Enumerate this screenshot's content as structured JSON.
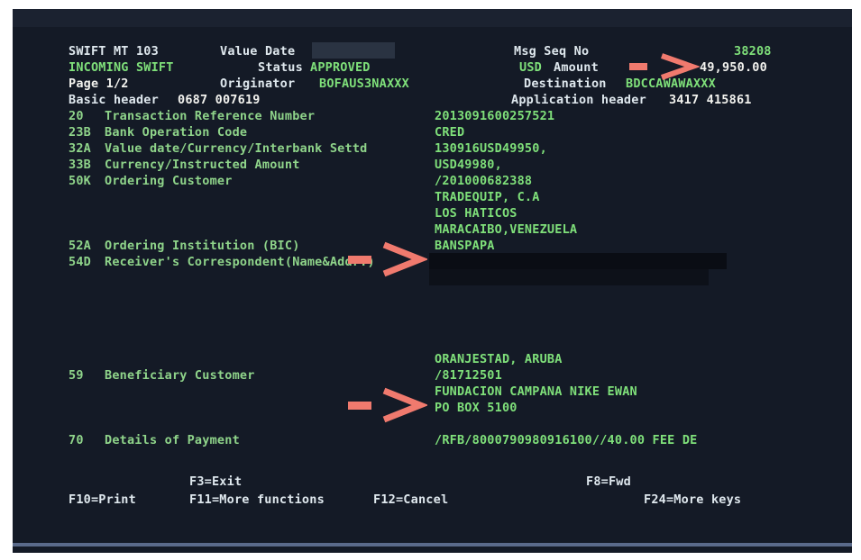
{
  "header": {
    "message_type": "SWIFT MT 103",
    "value_date_label": "Value Date",
    "value_date": "",
    "msg_seq_label": "Msg Seq No",
    "msg_seq": "38208",
    "incoming": "INCOMING SWIFT",
    "status_label": "Status",
    "status_value": "APPROVED",
    "currency_label": "USD",
    "amount_label": "Amount",
    "amount_value": "49,950.00",
    "page": "Page 1/2",
    "originator_label": "Originator",
    "originator_value": "BOFAUS3NAXXX",
    "destination_label": "Destination",
    "destination_value": "BDCCAWAWAXXX",
    "basic_header_label": "Basic header",
    "basic_header_value": "0687 007619",
    "app_header_label": "Application header",
    "app_header_value": "3417 415861"
  },
  "fields": [
    {
      "tag": "20",
      "name": "Transaction Reference Number",
      "value": "2013091600257521"
    },
    {
      "tag": "23B",
      "name": "Bank Operation Code",
      "value": "CRED"
    },
    {
      "tag": "32A",
      "name": "Value date/Currency/Interbank Settd",
      "value": "130916USD49950,"
    },
    {
      "tag": "33B",
      "name": "Currency/Instructed Amount",
      "value": "USD49980,"
    },
    {
      "tag": "50K",
      "name": "Ordering Customer",
      "value": "/201000682388"
    },
    {
      "tag": "",
      "name": "",
      "value": "TRADEQUIP, C.A"
    },
    {
      "tag": "",
      "name": "",
      "value": "LOS HATICOS"
    },
    {
      "tag": "",
      "name": "",
      "value": "MARACAIBO,VENEZUELA"
    },
    {
      "tag": "52A",
      "name": "Ordering Institution (BIC)",
      "value": "BANSPAPA"
    },
    {
      "tag": "54D",
      "name": "Receiver's Correspondent(Name&Addr.)",
      "value": ""
    },
    {
      "tag": "",
      "name": "",
      "value": ""
    },
    {
      "tag": "",
      "name": "",
      "value": "ORANJESTAD, ARUBA"
    },
    {
      "tag": "59",
      "name": "Beneficiary Customer",
      "value": "/81712501"
    },
    {
      "tag": "",
      "name": "",
      "value": "FUNDACION CAMPANA NIKE EWAN"
    },
    {
      "tag": "",
      "name": "",
      "value": "PO BOX 5100"
    },
    {
      "tag": "70",
      "name": "Details of Payment",
      "value": "/RFB/8000790980916100//40.00 FEE DE"
    }
  ],
  "function_keys": {
    "f3": "F3=Exit",
    "f8": "F8=Fwd",
    "f10": "F10=Print",
    "f11": "F11=More functions",
    "f12": "F12=Cancel",
    "f24": "F24=More keys"
  },
  "colors": {
    "background": "#141a26",
    "field_text": "#7fe07a",
    "highlight_text": "#f2f2ee",
    "annotation_arrow": "#f07a6e"
  }
}
